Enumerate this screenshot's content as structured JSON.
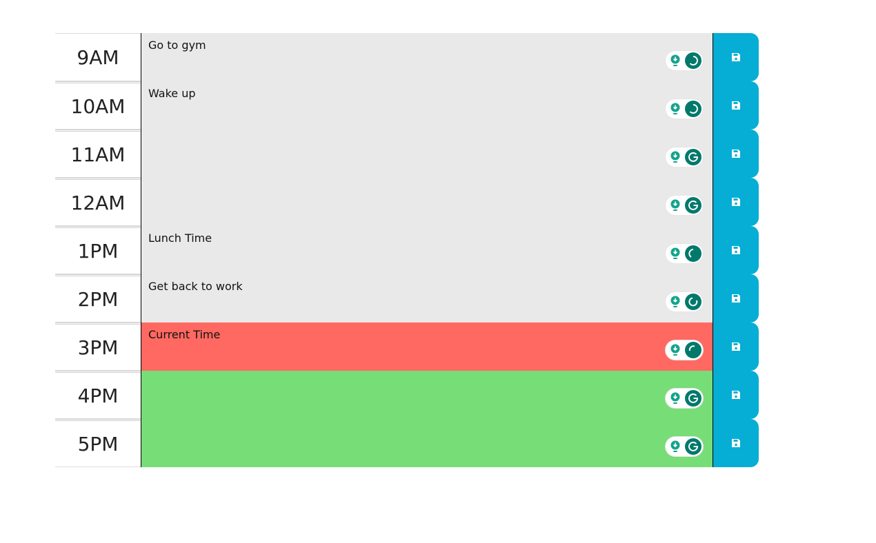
{
  "rows": [
    {
      "hour": "9AM",
      "text": "Go to gym",
      "state": "past"
    },
    {
      "hour": "10AM",
      "text": "Wake up",
      "state": "past"
    },
    {
      "hour": "11AM",
      "text": "",
      "state": "past"
    },
    {
      "hour": "12AM",
      "text": "",
      "state": "past"
    },
    {
      "hour": "1PM",
      "text": "Lunch Time",
      "state": "past"
    },
    {
      "hour": "2PM",
      "text": "Get back to work",
      "state": "past"
    },
    {
      "hour": "3PM",
      "text": "Current Time",
      "state": "present"
    },
    {
      "hour": "4PM",
      "text": "",
      "state": "future"
    },
    {
      "hour": "5PM",
      "text": "",
      "state": "future"
    }
  ],
  "icons": {
    "save": "floppy-disk-icon",
    "extension_bulb": "lightbulb-icon",
    "extension_grammar": "grammar-g-icon"
  },
  "colors": {
    "past": "#e9e9e9",
    "present": "#ff6961",
    "future": "#77dd77",
    "save_button": "#06aed5"
  }
}
